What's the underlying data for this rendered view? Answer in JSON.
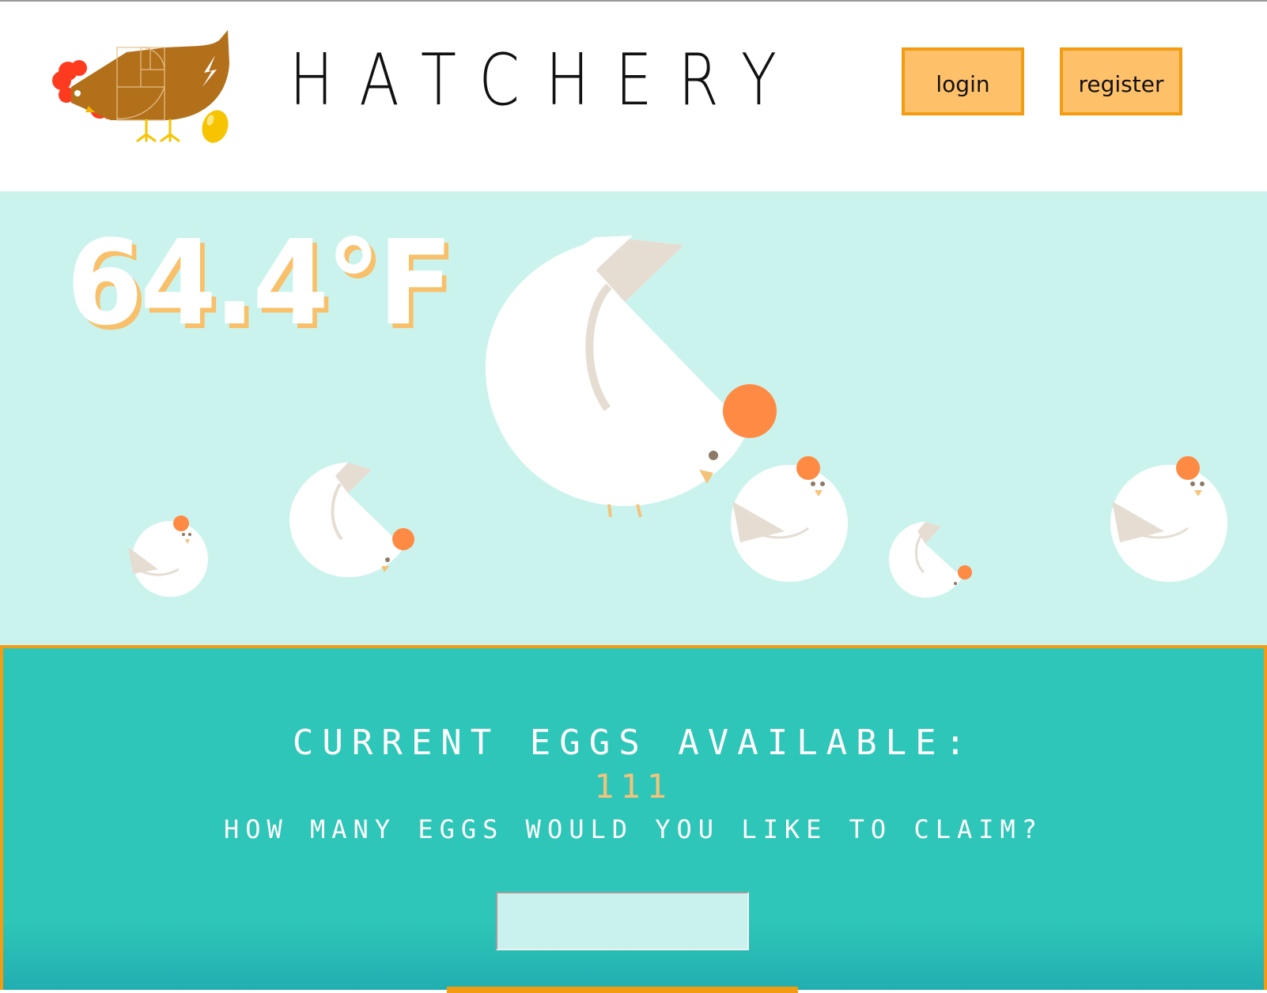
{
  "header": {
    "title": "HATCHERY",
    "login_label": "login",
    "register_label": "register"
  },
  "hero": {
    "temperature": "64.4°F"
  },
  "claim": {
    "available_label": "CURRENT EGGS AVAILABLE:",
    "available_count": "111",
    "question_label": "HOW MANY EGGS WOULD YOU LIKE TO CLAIM?",
    "input_value": ""
  },
  "colors": {
    "accent_orange": "#f39c12",
    "button_fill": "#ffc06a",
    "hero_bg": "#cbf3ee",
    "panel_bg": "#2ec6b8",
    "count_color": "#f4c37a",
    "comb": "#ff8a44"
  },
  "icons": {
    "logo": "hen-with-golden-egg-logo",
    "illustration": "white-hens-flock"
  }
}
